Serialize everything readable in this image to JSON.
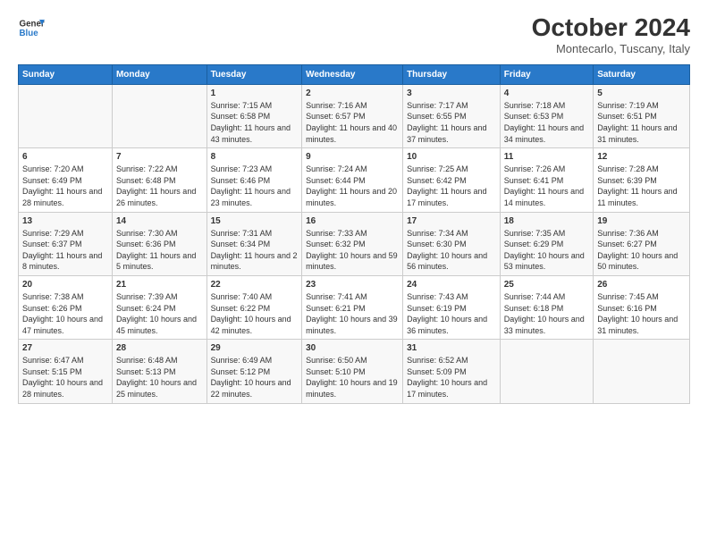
{
  "header": {
    "logo_line1": "General",
    "logo_line2": "Blue",
    "main_title": "October 2024",
    "subtitle": "Montecarlo, Tuscany, Italy"
  },
  "days_of_week": [
    "Sunday",
    "Monday",
    "Tuesday",
    "Wednesday",
    "Thursday",
    "Friday",
    "Saturday"
  ],
  "weeks": [
    [
      {
        "day": "",
        "info": ""
      },
      {
        "day": "",
        "info": ""
      },
      {
        "day": "1",
        "info": "Sunrise: 7:15 AM\nSunset: 6:58 PM\nDaylight: 11 hours and 43 minutes."
      },
      {
        "day": "2",
        "info": "Sunrise: 7:16 AM\nSunset: 6:57 PM\nDaylight: 11 hours and 40 minutes."
      },
      {
        "day": "3",
        "info": "Sunrise: 7:17 AM\nSunset: 6:55 PM\nDaylight: 11 hours and 37 minutes."
      },
      {
        "day": "4",
        "info": "Sunrise: 7:18 AM\nSunset: 6:53 PM\nDaylight: 11 hours and 34 minutes."
      },
      {
        "day": "5",
        "info": "Sunrise: 7:19 AM\nSunset: 6:51 PM\nDaylight: 11 hours and 31 minutes."
      }
    ],
    [
      {
        "day": "6",
        "info": "Sunrise: 7:20 AM\nSunset: 6:49 PM\nDaylight: 11 hours and 28 minutes."
      },
      {
        "day": "7",
        "info": "Sunrise: 7:22 AM\nSunset: 6:48 PM\nDaylight: 11 hours and 26 minutes."
      },
      {
        "day": "8",
        "info": "Sunrise: 7:23 AM\nSunset: 6:46 PM\nDaylight: 11 hours and 23 minutes."
      },
      {
        "day": "9",
        "info": "Sunrise: 7:24 AM\nSunset: 6:44 PM\nDaylight: 11 hours and 20 minutes."
      },
      {
        "day": "10",
        "info": "Sunrise: 7:25 AM\nSunset: 6:42 PM\nDaylight: 11 hours and 17 minutes."
      },
      {
        "day": "11",
        "info": "Sunrise: 7:26 AM\nSunset: 6:41 PM\nDaylight: 11 hours and 14 minutes."
      },
      {
        "day": "12",
        "info": "Sunrise: 7:28 AM\nSunset: 6:39 PM\nDaylight: 11 hours and 11 minutes."
      }
    ],
    [
      {
        "day": "13",
        "info": "Sunrise: 7:29 AM\nSunset: 6:37 PM\nDaylight: 11 hours and 8 minutes."
      },
      {
        "day": "14",
        "info": "Sunrise: 7:30 AM\nSunset: 6:36 PM\nDaylight: 11 hours and 5 minutes."
      },
      {
        "day": "15",
        "info": "Sunrise: 7:31 AM\nSunset: 6:34 PM\nDaylight: 11 hours and 2 minutes."
      },
      {
        "day": "16",
        "info": "Sunrise: 7:33 AM\nSunset: 6:32 PM\nDaylight: 10 hours and 59 minutes."
      },
      {
        "day": "17",
        "info": "Sunrise: 7:34 AM\nSunset: 6:30 PM\nDaylight: 10 hours and 56 minutes."
      },
      {
        "day": "18",
        "info": "Sunrise: 7:35 AM\nSunset: 6:29 PM\nDaylight: 10 hours and 53 minutes."
      },
      {
        "day": "19",
        "info": "Sunrise: 7:36 AM\nSunset: 6:27 PM\nDaylight: 10 hours and 50 minutes."
      }
    ],
    [
      {
        "day": "20",
        "info": "Sunrise: 7:38 AM\nSunset: 6:26 PM\nDaylight: 10 hours and 47 minutes."
      },
      {
        "day": "21",
        "info": "Sunrise: 7:39 AM\nSunset: 6:24 PM\nDaylight: 10 hours and 45 minutes."
      },
      {
        "day": "22",
        "info": "Sunrise: 7:40 AM\nSunset: 6:22 PM\nDaylight: 10 hours and 42 minutes."
      },
      {
        "day": "23",
        "info": "Sunrise: 7:41 AM\nSunset: 6:21 PM\nDaylight: 10 hours and 39 minutes."
      },
      {
        "day": "24",
        "info": "Sunrise: 7:43 AM\nSunset: 6:19 PM\nDaylight: 10 hours and 36 minutes."
      },
      {
        "day": "25",
        "info": "Sunrise: 7:44 AM\nSunset: 6:18 PM\nDaylight: 10 hours and 33 minutes."
      },
      {
        "day": "26",
        "info": "Sunrise: 7:45 AM\nSunset: 6:16 PM\nDaylight: 10 hours and 31 minutes."
      }
    ],
    [
      {
        "day": "27",
        "info": "Sunrise: 6:47 AM\nSunset: 5:15 PM\nDaylight: 10 hours and 28 minutes."
      },
      {
        "day": "28",
        "info": "Sunrise: 6:48 AM\nSunset: 5:13 PM\nDaylight: 10 hours and 25 minutes."
      },
      {
        "day": "29",
        "info": "Sunrise: 6:49 AM\nSunset: 5:12 PM\nDaylight: 10 hours and 22 minutes."
      },
      {
        "day": "30",
        "info": "Sunrise: 6:50 AM\nSunset: 5:10 PM\nDaylight: 10 hours and 19 minutes."
      },
      {
        "day": "31",
        "info": "Sunrise: 6:52 AM\nSunset: 5:09 PM\nDaylight: 10 hours and 17 minutes."
      },
      {
        "day": "",
        "info": ""
      },
      {
        "day": "",
        "info": ""
      }
    ]
  ]
}
